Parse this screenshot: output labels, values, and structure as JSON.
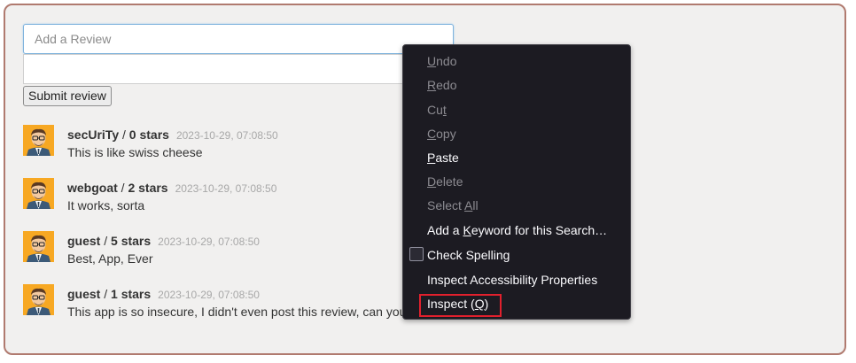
{
  "form": {
    "review_placeholder": "Add a Review",
    "submit_label": "Submit review"
  },
  "reviews": [
    {
      "author": "secUriTy",
      "separator": " / ",
      "stars": "0 stars",
      "date": "2023-10-29, 07:08:50",
      "text": "This is like swiss cheese"
    },
    {
      "author": "webgoat",
      "separator": " / ",
      "stars": "2 stars",
      "date": "2023-10-29, 07:08:50",
      "text": "It works, sorta"
    },
    {
      "author": "guest",
      "separator": " / ",
      "stars": "5 stars",
      "date": "2023-10-29, 07:08:50",
      "text": "Best, App, Ever"
    },
    {
      "author": "guest",
      "separator": " / ",
      "stars": "1 stars",
      "date": "2023-10-29, 07:08:50",
      "text": "This app is so insecure, I didn't even post this review, can you"
    }
  ],
  "context_menu": {
    "undo": {
      "pre": "",
      "key": "U",
      "post": "ndo"
    },
    "redo": {
      "pre": "",
      "key": "R",
      "post": "edo"
    },
    "cut": {
      "pre": "Cu",
      "key": "t",
      "post": ""
    },
    "copy": {
      "pre": "",
      "key": "C",
      "post": "opy"
    },
    "paste": {
      "pre": "",
      "key": "P",
      "post": "aste"
    },
    "delete": {
      "pre": "",
      "key": "D",
      "post": "elete"
    },
    "select_all": {
      "pre": "Select ",
      "key": "A",
      "post": "ll"
    },
    "add_keyword": {
      "pre": "Add a ",
      "key": "K",
      "post": "eyword for this Search…"
    },
    "check_spelling": {
      "pre": "Check Spellin",
      "key": "g",
      "post": ""
    },
    "inspect_accessibility": {
      "pre": "Inspect Accessibility Properties",
      "key": "",
      "post": ""
    },
    "inspect": {
      "pre": "Inspect (",
      "key": "Q",
      "post": ")"
    }
  },
  "colors": {
    "panel_border": "#b07a6f",
    "menu_background": "#1c1b22",
    "highlight": "#e1202d",
    "avatar_background": "#f7a823"
  },
  "icons": [
    "user-avatar-icon",
    "checkbox-icon"
  ]
}
